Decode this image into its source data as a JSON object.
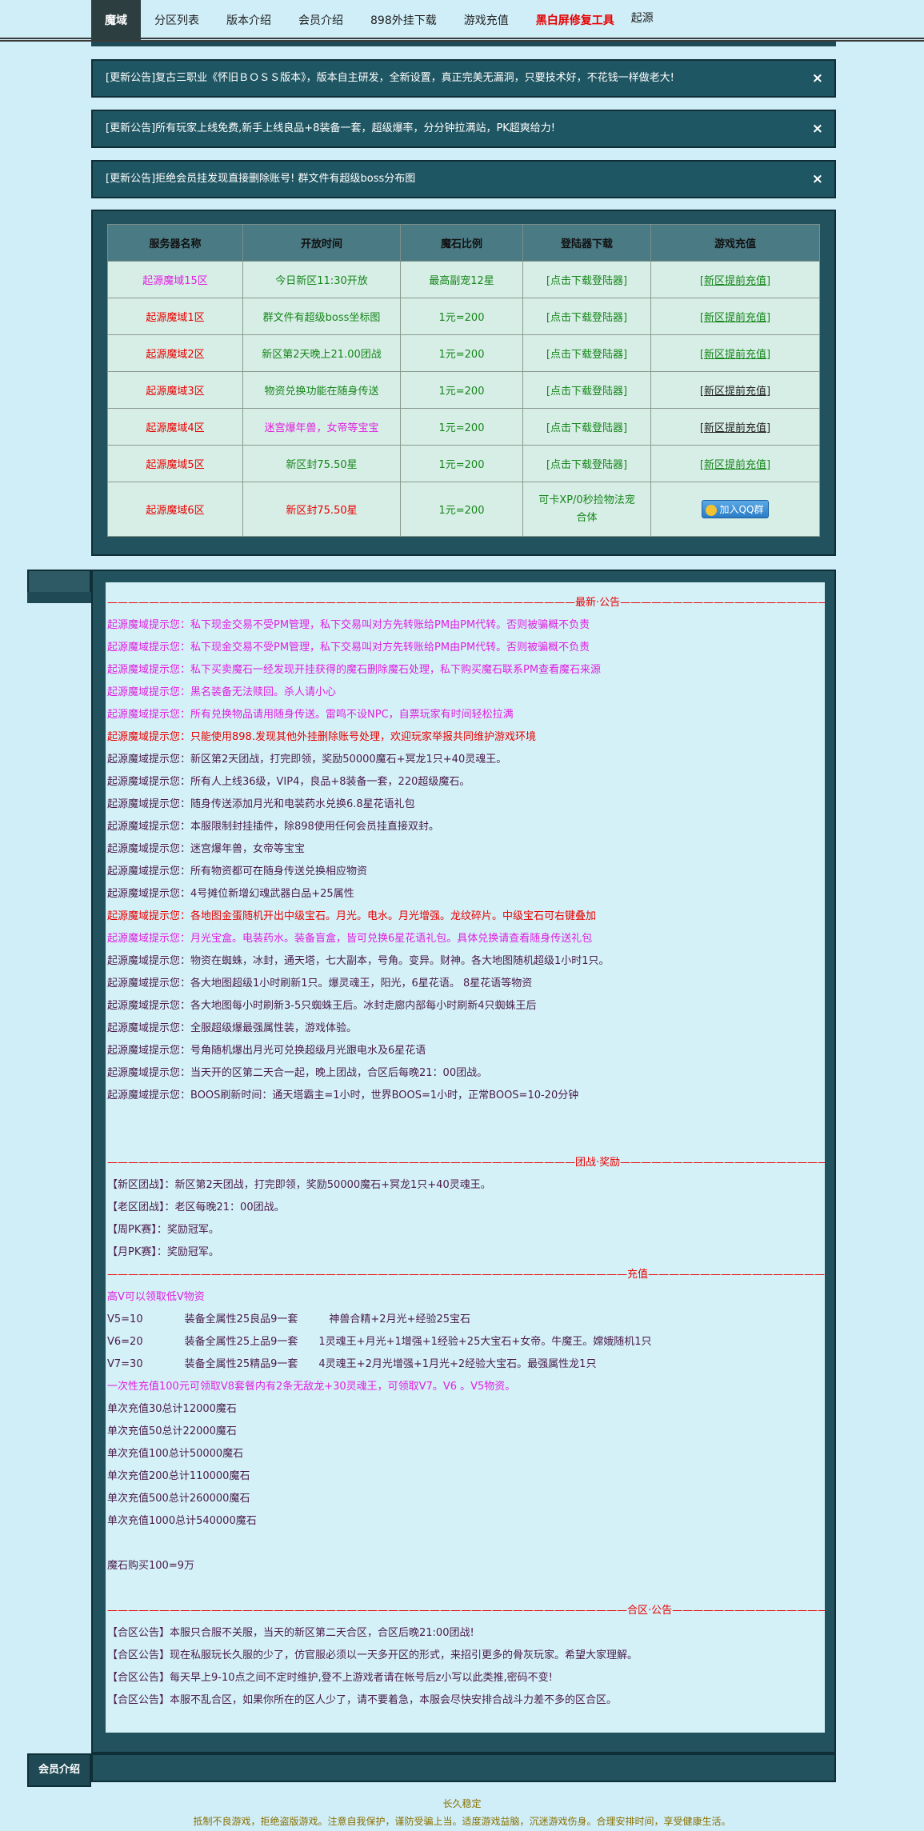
{
  "nav": {
    "items": [
      "魔域",
      "分区列表",
      "版本介绍",
      "会员介绍",
      "898外挂下载",
      "游戏充值",
      "黑白屏修复工具",
      "起源"
    ]
  },
  "notices": [
    "[更新公告]复古三职业《怀旧ＢＯＳＳ版本》，版本自主研发，全新设置，真正完美无漏洞，只要技术好，不花钱一样做老大!",
    "[更新公告]所有玩家上线免费,新手上线良品+8装备一套，超级爆率，分分钟拉满站，PK超爽给力!",
    "[更新公告]拒绝会员挂发现直接删除账号! 群文件有超级boss分布图"
  ],
  "notice_close": "×",
  "table": {
    "headers": [
      "服务器名称",
      "开放时间",
      "魔石比例",
      "登陆器下载",
      "游戏充值"
    ],
    "rows": [
      {
        "name": "起源魔域15区",
        "open": "今日新区11:30开放",
        "ratio": "最高副宠12星",
        "download": "[点击下载登陆器]",
        "recharge": "[新区提前充值]"
      },
      {
        "name": "起源魔域1区",
        "open": "群文件有超级boss坐标图",
        "ratio": "1元=200",
        "download": "[点击下载登陆器]",
        "recharge": "[新区提前充值]"
      },
      {
        "name": "起源魔域2区",
        "open": "新区第2天晚上21.00团战",
        "ratio": "1元=200",
        "download": "[点击下载登陆器]",
        "recharge": "[新区提前充值]"
      },
      {
        "name": "起源魔域3区",
        "open": "物资兑换功能在随身传送",
        "ratio": "1元=200",
        "download": "[点击下载登陆器]",
        "recharge": "[新区提前充值]"
      },
      {
        "name": "起源魔域4区",
        "open": "迷宫爆年兽，女帝等宝宝",
        "ratio": "1元=200",
        "download": "[点击下载登陆器]",
        "recharge": "[新区提前充值]"
      },
      {
        "name": "起源魔域5区",
        "open": "新区封75.50星",
        "ratio": "1元=200",
        "download": "[点击下载登陆器]",
        "recharge": "[新区提前充值]"
      },
      {
        "name": "起源魔域6区",
        "open": "新区封75.50星",
        "ratio": "1元=200",
        "download": "可卡XP/0秒捡物法宠合体",
        "recharge": "加入QQ群"
      }
    ]
  },
  "sections": {
    "latest_title": "—————————————————————————————————————————————最新·公告—————————————————————————————————————————————",
    "latest": [
      "起源魔域提示您：私下现金交易不受PM管理，私下交易叫对方先转账给PM由PM代转。否则被骗概不负责",
      "起源魔域提示您：私下现金交易不受PM管理，私下交易叫对方先转账给PM由PM代转。否则被骗概不负责",
      "起源魔域提示您：私下买卖魔石一经发现开挂获得的魔石删除魔石处理，私下购买魔石联系PM查看魔石来源",
      "起源魔域提示您：黑名装备无法赎回。杀人请小心",
      "起源魔域提示您：所有兑换物品请用随身传送。雷鸣不设NPC，自票玩家有时间轻松拉满",
      "起源魔域提示您：只能使用898.发现其他外挂删除账号处理，欢迎玩家举报共同维护游戏环境",
      "起源魔域提示您：新区第2天团战，打完即领，奖励50000魔石+冥龙1只+40灵魂王。",
      "起源魔域提示您：所有人上线36级，VIP4，良品+8装备一套，220超级魔石。",
      "起源魔域提示您：随身传送添加月光和电装药水兑换6.8星花语礼包",
      "起源魔域提示您：本服限制封挂插件，除898使用任何会员挂直接双封。",
      "起源魔域提示您：迷宫爆年兽，女帝等宝宝",
      "起源魔域提示您：所有物资都可在随身传送兑换相应物资",
      "起源魔域提示您：4号摊位新增幻魂武器白品+25属性",
      "起源魔域提示您：各地图金蛋随机开出中级宝石。月光。电水。月光增强。龙纹碎片。中级宝石可右键叠加",
      "起源魔域提示您：月光宝盒。电装药水。装备盲盒，皆可兑换6星花语礼包。具体兑换请查看随身传送礼包",
      "起源魔域提示您：物资在蜘蛛，冰封，通天塔，七大副本，号角。变异。财神。各大地图随机超级1小时1只。",
      "起源魔域提示您：各大地图超级1小时刷新1只。爆灵魂王，阳光，6星花语。 8星花语等物资",
      "起源魔域提示您：各大地图每小时刷新3-5只蜘蛛王后。冰封走廊内部每小时刷新4只蜘蛛王后",
      "起源魔域提示您：全服超级爆最强属性装，游戏体验。",
      "起源魔域提示您：号角随机爆出月光可兑换超级月光跟电水及6星花语",
      "起源魔域提示您：当天开的区第二天合一起，晚上团战，合区后每晚21：00团战。",
      "起源魔域提示您：BOOS刷新时间：通天塔霸主=1小时，世界BOOS=1小时，正常BOOS=10-20分钟"
    ],
    "battle_title": "—————————————————————————————————————————————团战·奖励————————————————————————————————————————————",
    "battle": [
      "【新区团战】：新区第2天团战，打完即领，奖励50000魔石+冥龙1只+40灵魂王。",
      "【老区团战】：老区每晚21：00团战。",
      "【周PK赛】：奖励冠军。",
      "【月PK赛】：奖励冠军。"
    ],
    "recharge_title": "——————————————————————————————————————————————————充值——————————————————————————————————————————————",
    "recharge_intro": "高V可以领取低V物资",
    "vip": [
      "V5=10　　　　装备全属性25良品9一套　　　神兽合精+2月光+经验25宝石",
      "V6=20　　　　装备全属性25上品9一套　　1灵魂王+月光+1增强+1经验+25大宝石+女帝。牛魔王。嫦娥随机1只",
      "V7=30　　　　装备全属性25精品9一套　　4灵魂王+2月光增强+1月光+2经验大宝石。最强属性龙1只"
    ],
    "vip_note": "一次性充值100元可领取V8套餐内有2条无敌龙+30灵魂王，可领取V7。V6 。V5物资。",
    "single": [
      "单次充值30总计12000魔石",
      "单次充值50总计22000魔石",
      "单次充值100总计50000魔石",
      "单次充值200总计110000魔石",
      "单次充值500总计260000魔石",
      "单次充值1000总计540000魔石"
    ],
    "buyback": "魔石购买100=9万",
    "merge_title": "——————————————————————————————————————————————————合区·公告——————————————————————————————————————————————————",
    "merge": [
      "【合区公告】本服只合服不关服，当天的新区第二天合区，合区后晚21:00团战!",
      "【合区公告】现在私服玩长久服的少了，仿官服必须以一天多开区的形式，来招引更多的骨灰玩家。希望大家理解。",
      "【合区公告】每天早上9-10点之间不定时维护,登不上游戏者请在帐号后z小写以此类推,密码不变!",
      "【合区公告】本服不乱合区，如果你所在的区人少了，请不要着急，本服会尽快安排合战斗力差不多的区合区。"
    ]
  },
  "bottom": {
    "label": "会员介绍"
  },
  "footer": {
    "line1": "长久稳定",
    "line2": "抵制不良游戏，拒绝盗版游戏。注意自我保护，谨防受骗上当。适度游戏益脑，沉迷游戏伤身。合理安排时间，享受健康生活。"
  }
}
